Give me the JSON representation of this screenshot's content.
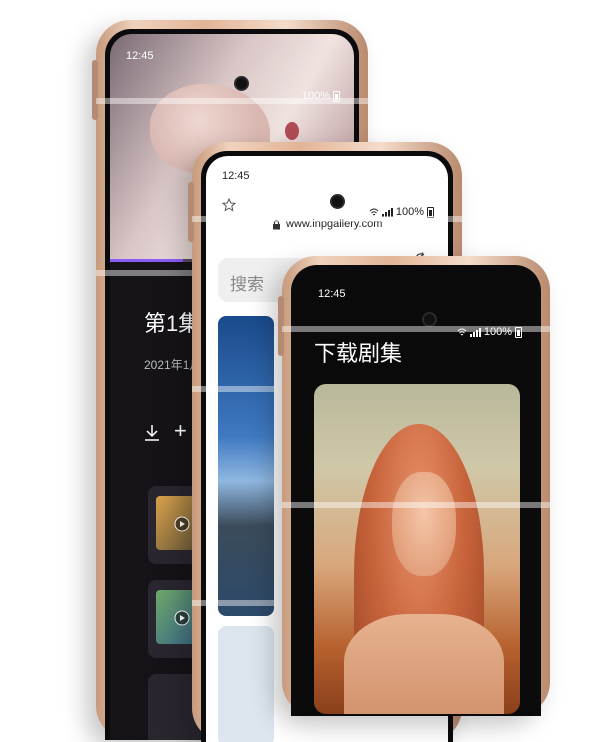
{
  "phone_back": {
    "time": "12:45",
    "battery": "100%",
    "episode_title": "第1集",
    "episode_date": "2021年1月",
    "action_add": "+"
  },
  "phone_mid": {
    "time": "12:45",
    "battery": "100%",
    "url": "www.inpgallery.com",
    "search_placeholder": "搜索"
  },
  "phone_front": {
    "time": "12:45",
    "battery": "100%",
    "heading": "下载剧集"
  }
}
